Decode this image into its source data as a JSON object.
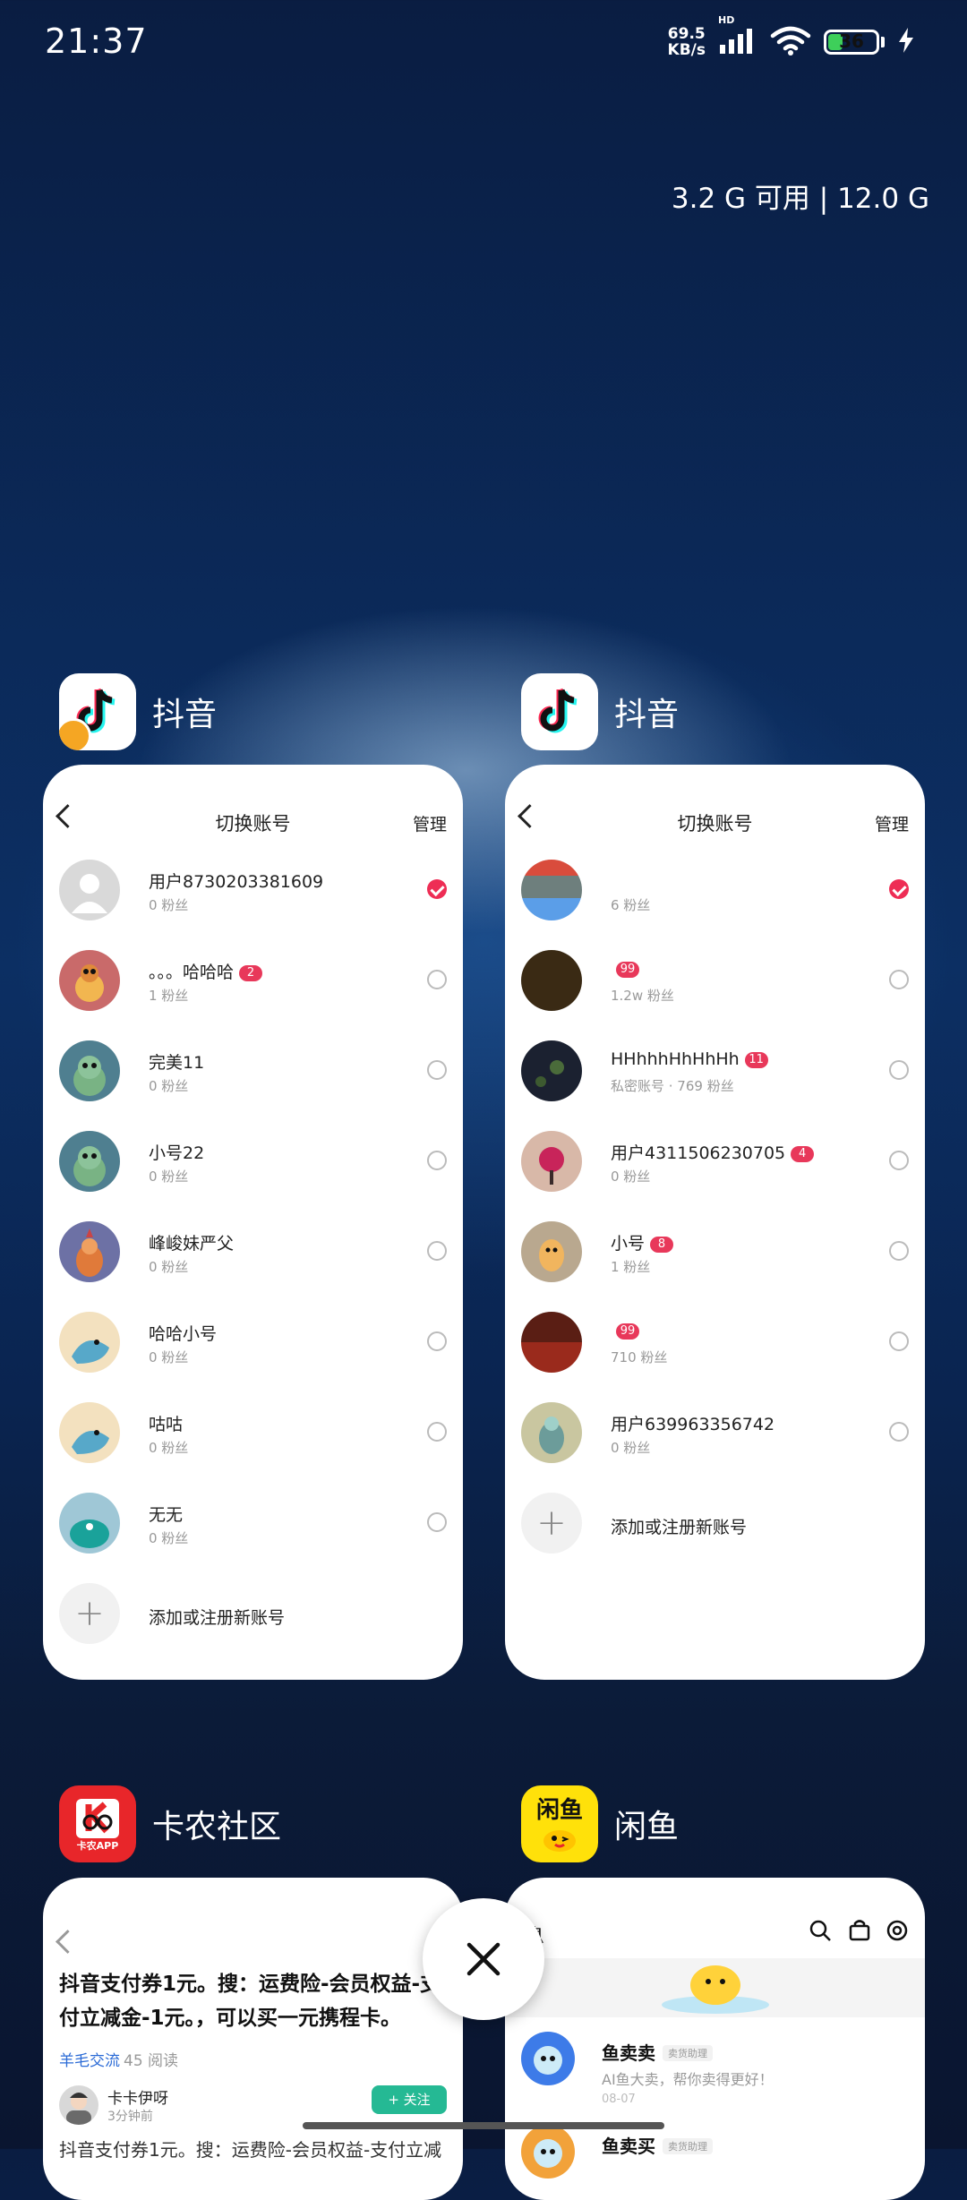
{
  "status_bar": {
    "time": "21:37",
    "net_speed_value": "69.5",
    "net_speed_unit": "KB/s",
    "network_type": "HD",
    "battery": "36",
    "battery_level": 0.36
  },
  "memory": {
    "label": "3.2 G 可用 | 12.0 G"
  },
  "apps": [
    {
      "name": "抖音",
      "screen_title": "切换账号",
      "manage_label": "管理",
      "accounts": [
        {
          "name": "用户8730203381609",
          "fans": "0 粉丝",
          "badge": "",
          "selected": true
        },
        {
          "name": "。。。哈哈哈",
          "fans": "1 粉丝",
          "badge": "2",
          "selected": false
        },
        {
          "name": "完美11",
          "fans": "0 粉丝",
          "badge": "",
          "selected": false
        },
        {
          "name": "小号22",
          "fans": "0 粉丝",
          "badge": "",
          "selected": false
        },
        {
          "name": "峰峻妹严父",
          "fans": "0 粉丝",
          "badge": "",
          "selected": false
        },
        {
          "name": "哈哈小号",
          "fans": "0 粉丝",
          "badge": "",
          "selected": false
        },
        {
          "name": "咕咕",
          "fans": "0 粉丝",
          "badge": "",
          "selected": false
        },
        {
          "name": "无无",
          "fans": "0 粉丝",
          "badge": "",
          "selected": false
        }
      ],
      "add_label": "添加或注册新账号"
    },
    {
      "name": "抖音",
      "screen_title": "切换账号",
      "manage_label": "管理",
      "accounts": [
        {
          "name": "",
          "fans": "6 粉丝",
          "badge": "",
          "selected": true
        },
        {
          "name": "",
          "fans": "1.2w 粉丝",
          "badge": "99",
          "selected": false
        },
        {
          "name": "HHhhhHhHhHh",
          "fans": "私密账号 · 769 粉丝",
          "badge": "11",
          "selected": false
        },
        {
          "name": "用户4311506230705",
          "fans": "0 粉丝",
          "badge": "4",
          "selected": false
        },
        {
          "name": "小号",
          "fans": "1 粉丝",
          "badge": "8",
          "selected": false
        },
        {
          "name": "",
          "fans": "710 粉丝",
          "badge": "99",
          "selected": false
        },
        {
          "name": "用户639963356742",
          "fans": "0 粉丝",
          "badge": "",
          "selected": false
        }
      ],
      "add_label": "添加或注册新账号"
    },
    {
      "name": "卡农社区",
      "icon_text": "卡农APP",
      "post_title": "抖音支付券1元。搜：运费险-会员权益-支付立减金-1元。，可以买一元携程卡。",
      "tag": "羊毛交流",
      "reads": "45 阅读",
      "author": "卡卡伊呀",
      "author_time": "3分钟前",
      "follow_label": "+ 关注",
      "body_preview": "抖音支付券1元。搜：运费险-会员权益-支付立减"
    },
    {
      "name": "闲鱼",
      "icon_text": "闲鱼",
      "header_title": "息",
      "messages": [
        {
          "name": "鱼卖卖",
          "tag": "卖货助理",
          "text": "AI鱼大卖，帮你卖得更好！",
          "date": "08-07"
        },
        {
          "name": "鱼卖买",
          "tag": "卖货助理",
          "text": "",
          "date": ""
        }
      ]
    }
  ]
}
